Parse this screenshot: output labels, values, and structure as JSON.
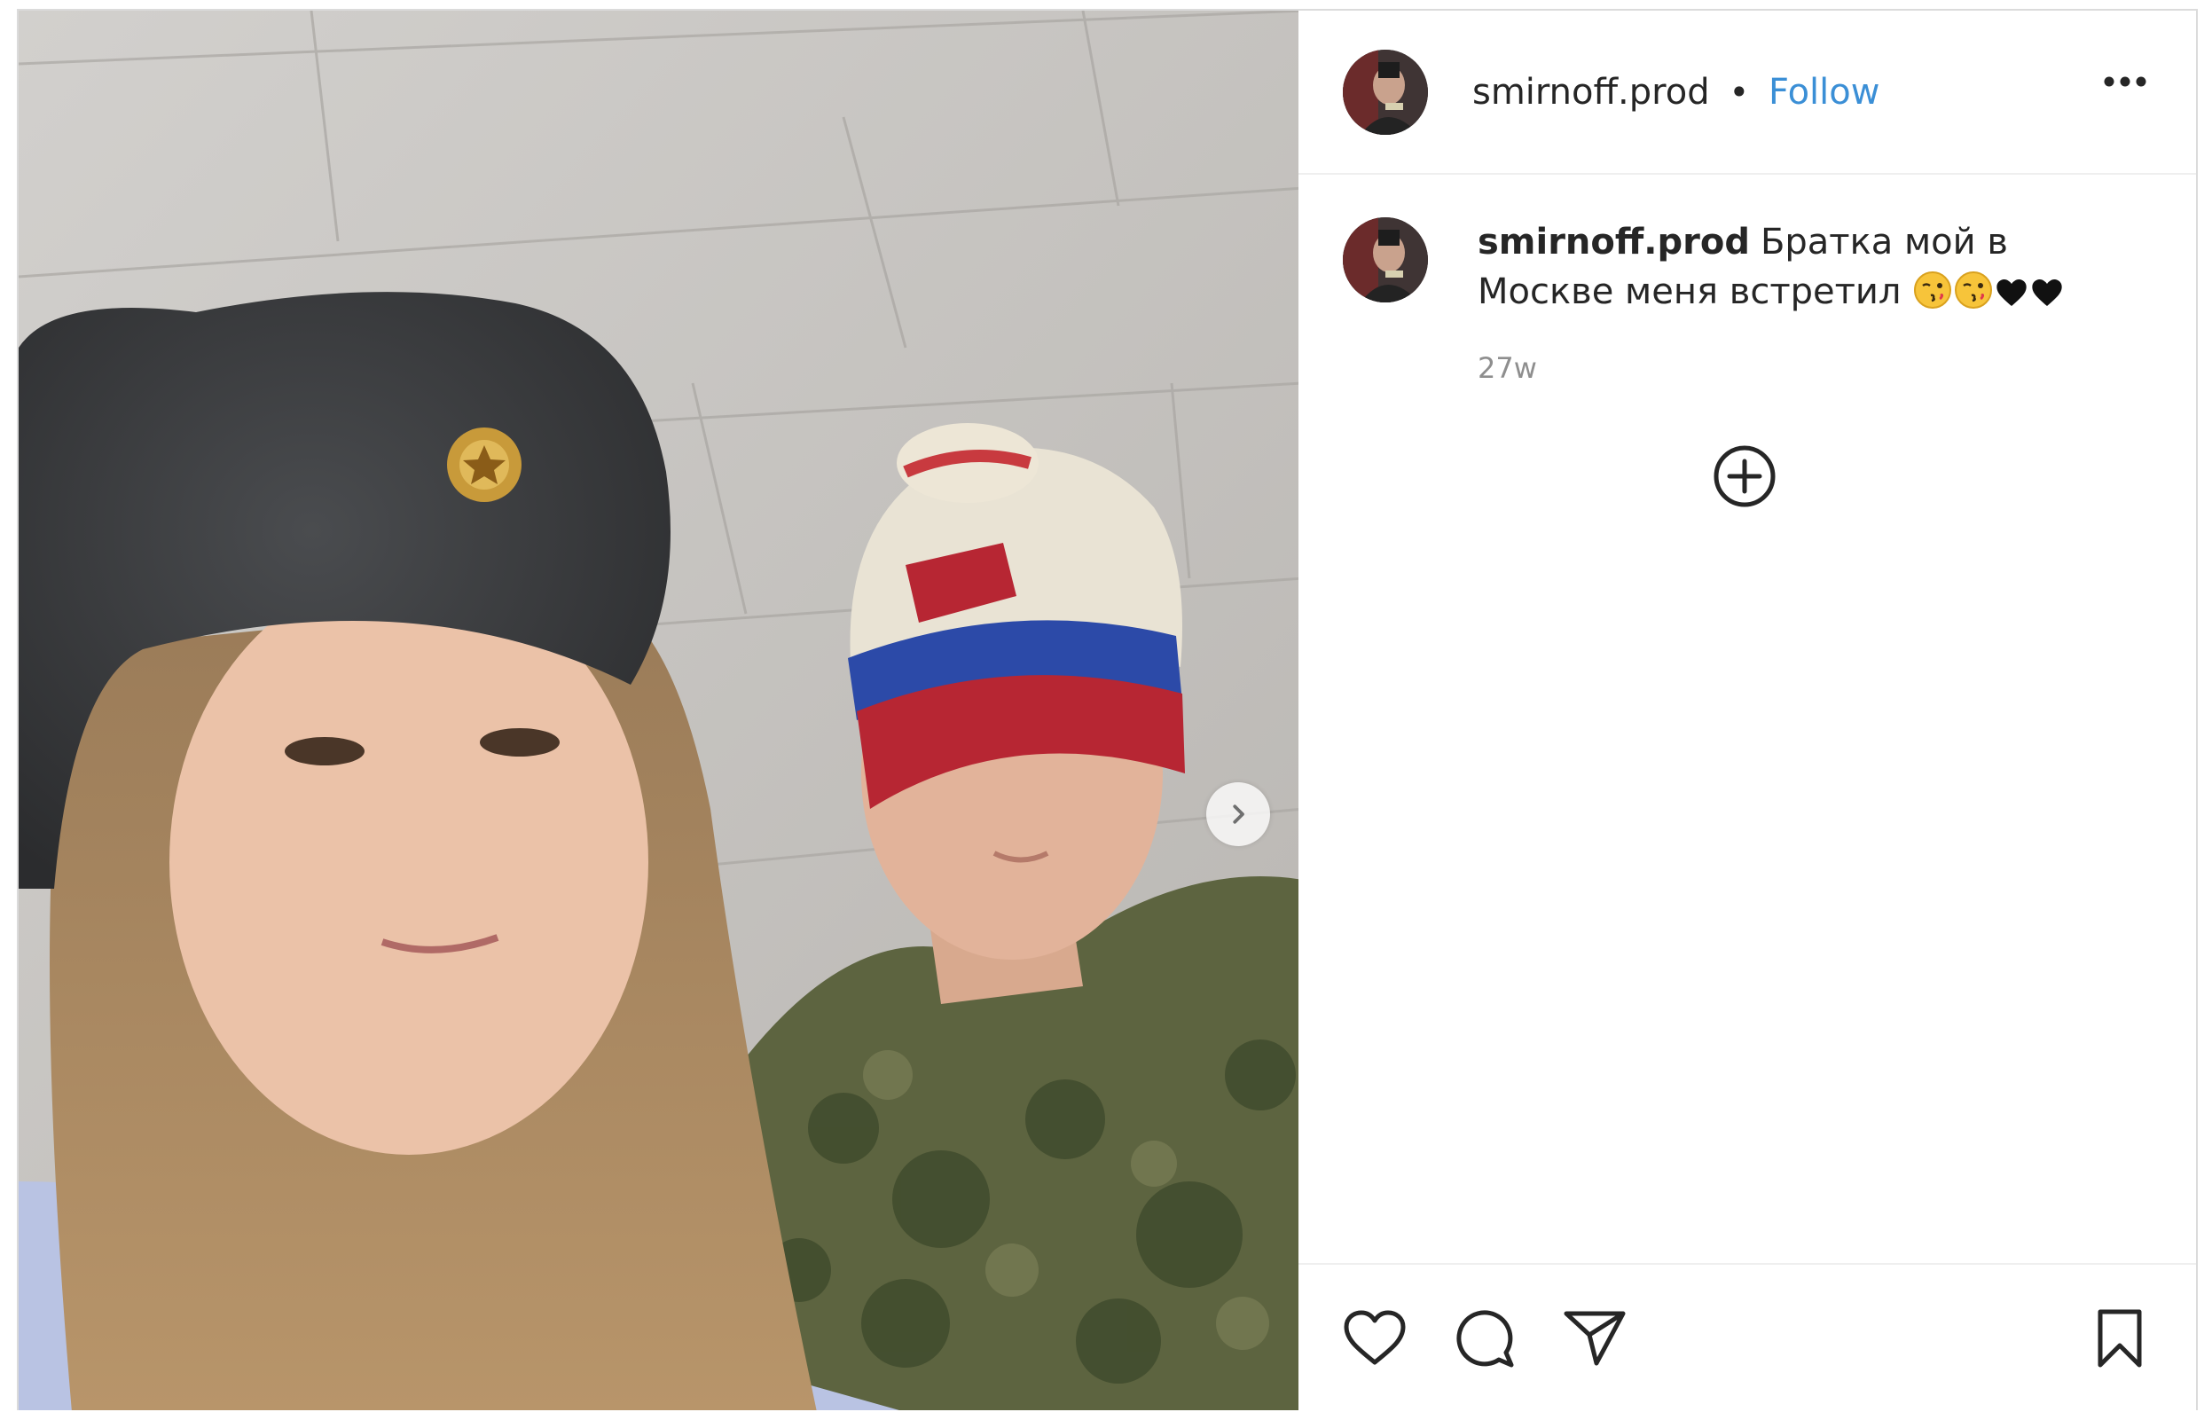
{
  "post": {
    "username": "smirnoff.prod",
    "separator": "•",
    "follow_label": "Follow",
    "caption_user": "smirnoff.prod",
    "caption_text": "Братка мой в Москве меня встретил",
    "caption_emojis": [
      "kissing-face-emoji",
      "kissing-face-emoji",
      "black-heart-emoji",
      "black-heart-emoji"
    ],
    "time_ago": "27w"
  },
  "icons": {
    "more": "more-options-icon",
    "next": "chevron-right-icon",
    "load_more": "plus-circle-icon",
    "like": "heart-icon",
    "comment": "comment-icon",
    "share": "send-icon",
    "save": "bookmark-icon"
  },
  "colors": {
    "follow": "#3b8fd6",
    "text": "#262626",
    "muted": "#8e8e8e",
    "border": "#dbdbdb"
  }
}
